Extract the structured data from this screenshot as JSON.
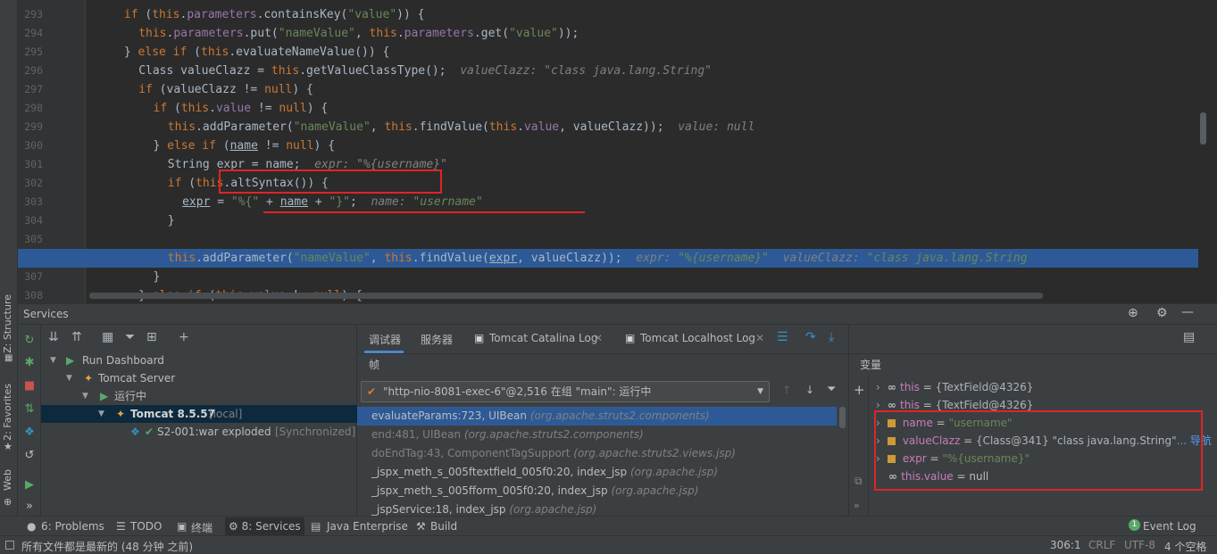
{
  "left_strip": {
    "structure": "Z: Structure",
    "favorites": "2: Favorites",
    "web": "Web"
  },
  "editor": {
    "lines": [
      {
        "n": "293",
        "code": [
          [
            "kw",
            "if "
          ],
          [
            "t",
            "("
          ],
          [
            "kw",
            "this"
          ],
          [
            "t",
            "."
          ],
          [
            "fld",
            "parameters"
          ],
          [
            "t",
            ".containsKey("
          ],
          [
            "str",
            "\"value\""
          ],
          [
            "t",
            ")) {"
          ]
        ],
        "indent": 3
      },
      {
        "n": "294",
        "code": [
          [
            "kw",
            "this"
          ],
          [
            "t",
            "."
          ],
          [
            "fld",
            "parameters"
          ],
          [
            "t",
            ".put("
          ],
          [
            "str",
            "\"nameValue\""
          ],
          [
            "t",
            ", "
          ],
          [
            "kw",
            "this"
          ],
          [
            "t",
            "."
          ],
          [
            "fld",
            "parameters"
          ],
          [
            "t",
            ".get("
          ],
          [
            "str",
            "\"value\""
          ],
          [
            "t",
            "));"
          ]
        ],
        "indent": 4
      },
      {
        "n": "295",
        "code": [
          [
            "t",
            "} "
          ],
          [
            "kw",
            "else if "
          ],
          [
            "t",
            "("
          ],
          [
            "kw",
            "this"
          ],
          [
            "t",
            ".evaluateNameValue()) {"
          ]
        ],
        "indent": 3
      },
      {
        "n": "296",
        "code": [
          [
            "t",
            "Class valueClazz = "
          ],
          [
            "kw",
            "this"
          ],
          [
            "t",
            ".getValueClassType();  "
          ],
          [
            "hint",
            "valueClazz: \"class java.lang.String\""
          ]
        ],
        "indent": 4
      },
      {
        "n": "297",
        "code": [
          [
            "kw",
            "if "
          ],
          [
            "t",
            "(valueClazz != "
          ],
          [
            "kw",
            "null"
          ],
          [
            "t",
            ") {"
          ]
        ],
        "indent": 4
      },
      {
        "n": "298",
        "code": [
          [
            "kw",
            "if "
          ],
          [
            "t",
            "("
          ],
          [
            "kw",
            "this"
          ],
          [
            "t",
            "."
          ],
          [
            "fld",
            "value"
          ],
          [
            "t",
            " != "
          ],
          [
            "kw",
            "null"
          ],
          [
            "t",
            ") {"
          ]
        ],
        "indent": 5
      },
      {
        "n": "299",
        "code": [
          [
            "kw",
            "this"
          ],
          [
            "t",
            ".addParameter("
          ],
          [
            "str",
            "\"nameValue\""
          ],
          [
            "t",
            ", "
          ],
          [
            "kw",
            "this"
          ],
          [
            "t",
            ".findValue("
          ],
          [
            "kw",
            "this"
          ],
          [
            "t",
            "."
          ],
          [
            "fld",
            "value"
          ],
          [
            "t",
            ", valueClazz));  "
          ],
          [
            "hint",
            "value: null"
          ]
        ],
        "indent": 6
      },
      {
        "n": "300",
        "code": [
          [
            "t",
            "} "
          ],
          [
            "kw",
            "else if "
          ],
          [
            "t",
            "("
          ],
          [
            "ul",
            "name"
          ],
          [
            "t",
            " != "
          ],
          [
            "kw",
            "null"
          ],
          [
            "t",
            ") {"
          ]
        ],
        "indent": 5
      },
      {
        "n": "301",
        "code": [
          [
            "t",
            "String expr = name;  "
          ],
          [
            "hint",
            "expr: \"%{username}\""
          ]
        ],
        "indent": 6
      },
      {
        "n": "302",
        "code": [
          [
            "kw",
            "if "
          ],
          [
            "t",
            "("
          ],
          [
            "kw",
            "this"
          ],
          [
            "t",
            ".altSyntax()) {"
          ]
        ],
        "indent": 6
      },
      {
        "n": "303",
        "code": [
          [
            "ul",
            "expr"
          ],
          [
            "t",
            " = "
          ],
          [
            "str",
            "\"%{\""
          ],
          [
            "t",
            " + "
          ],
          [
            "ul",
            "name"
          ],
          [
            "t",
            " + "
          ],
          [
            "str",
            "\"}\""
          ],
          [
            "t",
            ";  "
          ],
          [
            "hint",
            "name: "
          ],
          [
            "hintv",
            "\"username\""
          ]
        ],
        "indent": 7
      },
      {
        "n": "304",
        "code": [
          [
            "t",
            "}"
          ]
        ],
        "indent": 6
      },
      {
        "n": "305",
        "code": [],
        "indent": 0
      },
      {
        "n": "306",
        "code": [
          [
            "kw",
            "this"
          ],
          [
            "t",
            ".addParameter("
          ],
          [
            "str",
            "\"nameValue\""
          ],
          [
            "t",
            ", "
          ],
          [
            "kw",
            "this"
          ],
          [
            "t",
            ".findValue("
          ],
          [
            "ul",
            "expr"
          ],
          [
            "t",
            ", valueClazz));  "
          ],
          [
            "hint",
            "expr: "
          ],
          [
            "hintv",
            "\"%{username}\""
          ],
          [
            "hint",
            "  valueClazz: "
          ],
          [
            "hintv",
            "\"class java.lang.String"
          ]
        ],
        "indent": 6
      },
      {
        "n": "307",
        "code": [
          [
            "t",
            "}"
          ]
        ],
        "indent": 5
      },
      {
        "n": "308",
        "code": [
          [
            "t",
            "} "
          ],
          [
            "kw",
            "else if "
          ],
          [
            "t",
            "("
          ],
          [
            "kw",
            "this"
          ],
          [
            "t",
            "."
          ],
          [
            "fld",
            "value"
          ],
          [
            "t",
            " != "
          ],
          [
            "kw",
            "null"
          ],
          [
            "t",
            ") {"
          ]
        ],
        "indent": 4
      }
    ]
  },
  "services": {
    "title": "Services",
    "tree": {
      "run_dashboard": "Run Dashboard",
      "tomcat_server": "Tomcat Server",
      "running": "运行中",
      "tomcat_name": "Tomcat 8.5.57",
      "tomcat_local": "[local]",
      "artifact": "S2-001:war exploded",
      "artifact_status": "[Synchronized]"
    },
    "debug_tabs": [
      "调试器",
      "服务器",
      "Tomcat Catalina Log",
      "Tomcat Localhost Log"
    ],
    "frames_label": "帧",
    "thread": "\"http-nio-8081-exec-6\"@2,516 在组 \"main\": 运行中",
    "frames": [
      {
        "method": "evaluateParams:723, UIBean",
        "pkg": "(org.apache.struts2.components)"
      },
      {
        "method": "end:481, UIBean",
        "pkg": "(org.apache.struts2.components)"
      },
      {
        "method": "doEndTag:43, ComponentTagSupport",
        "pkg": "(org.apache.struts2.views.jsp)"
      },
      {
        "method": "_jspx_meth_s_005ftextfield_005f0:20, index_jsp",
        "pkg": "(org.apache.jsp)"
      },
      {
        "method": "_jspx_meth_s_005fform_005f0:20, index_jsp",
        "pkg": "(org.apache.jsp)"
      },
      {
        "method": "_jspService:18, index_jsp",
        "pkg": "(org.apache.jsp)"
      }
    ],
    "vars_label": "变量",
    "variables": [
      {
        "name": "this",
        "eq": " = ",
        "value": "{TextField@4326}",
        "kind": "oo"
      },
      {
        "name": "this",
        "eq": " = ",
        "value": "{TextField@4326}",
        "kind": "oo"
      },
      {
        "name": "name",
        "eq": " = ",
        "value": "\"username\"",
        "kind": "field"
      },
      {
        "name": "valueClazz",
        "eq": " = ",
        "value": "{Class@341} \"class java.lang.String\"",
        "extra": "... 导航",
        "kind": "field"
      },
      {
        "name": "expr",
        "eq": " = ",
        "value": "\"%{username}\"",
        "kind": "field"
      },
      {
        "name": "this.value",
        "eq": " = ",
        "value": "null",
        "kind": "oo"
      }
    ]
  },
  "bottom_tabs": {
    "problems": "6: Problems",
    "todo": "TODO",
    "terminal": "终端",
    "services": "8: Services",
    "java_ee": "Java Enterprise",
    "build": "Build",
    "event_log_count": "1",
    "event_log": "Event Log"
  },
  "status": {
    "message": "所有文件都是最新的 (48 分钟 之前)",
    "position": "306:1",
    "line_sep": "CRLF",
    "encoding": "UTF-8",
    "indent": "4 个空格"
  }
}
